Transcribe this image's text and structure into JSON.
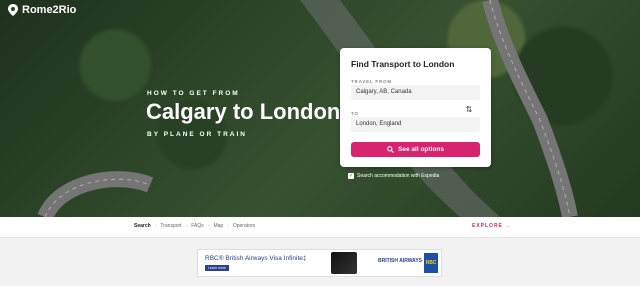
{
  "brand": {
    "name": "Rome2Rio"
  },
  "hero": {
    "eyebrow": "HOW TO GET FROM",
    "title": "Calgary to London",
    "subeyebrow": "BY PLANE OR TRAIN"
  },
  "search_card": {
    "heading": "Find Transport to London",
    "from_label": "TRAVEL FROM",
    "from_value": "Calgary, AB, Canada",
    "to_label": "TO",
    "to_value": "London, England",
    "cta_label": "See all options",
    "accommodation_label": "Search accommodation with Expedia",
    "accommodation_checked": true
  },
  "nav": {
    "links": [
      "Search",
      "Transport",
      "FAQs",
      "Map",
      "Operators"
    ],
    "separator": "·",
    "explore_label": "EXPLORE"
  },
  "ad": {
    "headline": "RBC® British Airways Visa Infinite‡",
    "learn_more": "Learn more",
    "airline": "BRITISH AIRWAYS",
    "bank": "RBC"
  },
  "colors": {
    "accent": "#d6246e",
    "bank_blue": "#2a3f8f"
  }
}
